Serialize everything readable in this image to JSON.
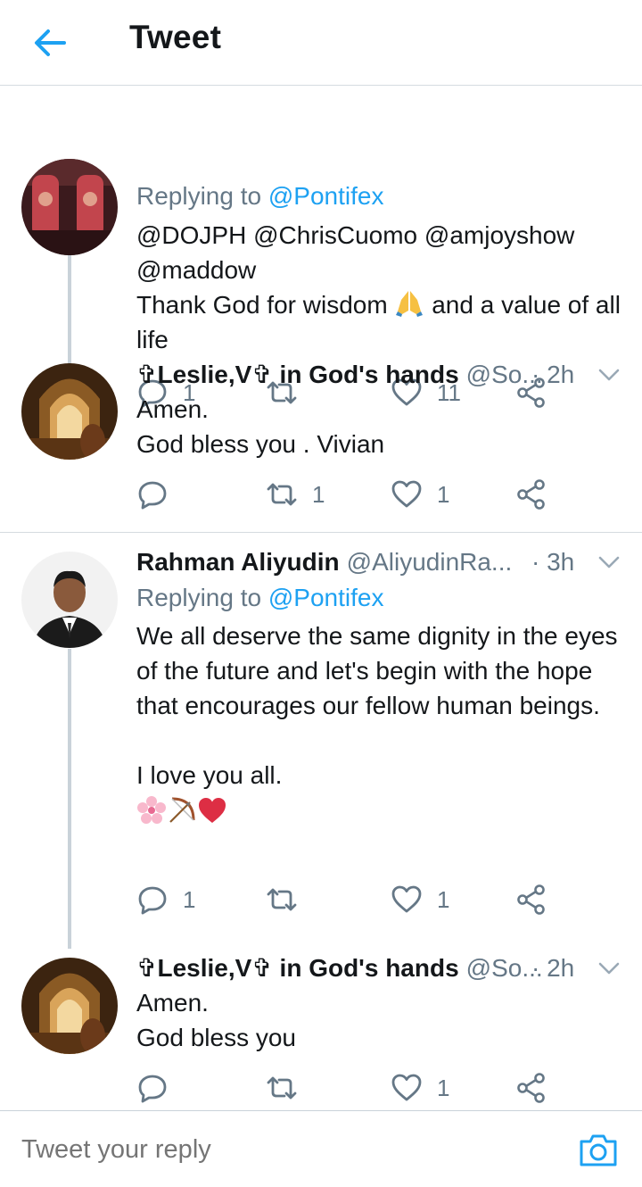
{
  "header": {
    "title": "Tweet"
  },
  "tweets": [
    {
      "replying_prefix": "Replying to",
      "replying_to": "@Pontifex",
      "mentions": "@DOJPH @ChrisCuomo @amjoyshow @maddow",
      "text_a": "Thank God for wisdom",
      "text_b": "and a value of all life",
      "emoji": "folded-hands",
      "replies": "1",
      "retweets": "",
      "likes": "11"
    },
    {
      "name": "✞Leslie,V✞ in God's hands",
      "handle": "@So...",
      "time": "· 2h",
      "line1": "Amen.",
      "line2": "God bless you . Vivian",
      "replies": "",
      "retweets": "1",
      "likes": "1"
    },
    {
      "name": "Rahman Aliyudin",
      "handle": "@AliyudinRa...",
      "time": "· 3h",
      "replying_prefix": "Replying to",
      "replying_to": "@Pontifex",
      "paragraph": "We all deserve the same dignity in the eyes of the future and let's begin with the hope that encourages our fellow human beings.",
      "line2": "I love you all.",
      "emojis": [
        "cherry-blossom",
        "bow-and-arrow",
        "red-heart"
      ],
      "replies": "1",
      "retweets": "",
      "likes": "1"
    },
    {
      "name": "✞Leslie,V✞ in God's hands",
      "handle": "@So...",
      "time": "· 2h",
      "line1": "Amen.",
      "line2": "God bless you",
      "replies": "",
      "retweets": "",
      "likes": "1"
    }
  ],
  "reply_bar": {
    "placeholder": "Tweet your reply"
  },
  "colors": {
    "accent": "#1da1f2",
    "muted": "#657786",
    "text": "#14171a",
    "icon": "#657786",
    "divider": "#d5dbe0"
  }
}
